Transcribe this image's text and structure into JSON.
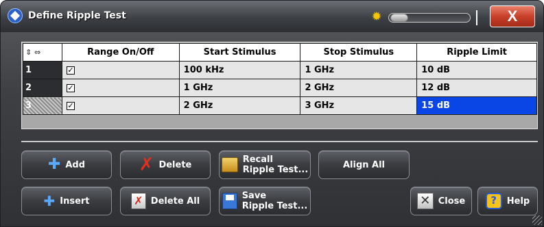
{
  "window": {
    "title": "Define Ripple Test",
    "close_label": "X"
  },
  "table": {
    "headers": [
      "Range On/Off",
      "Start Stimulus",
      "Stop Stimulus",
      "Ripple Limit"
    ],
    "rows": [
      {
        "num": "1",
        "checked": "☑",
        "start": "100 kHz",
        "stop": "1 GHz",
        "limit": "10 dB"
      },
      {
        "num": "2",
        "checked": "☑",
        "start": "1 GHz",
        "stop": "2 GHz",
        "limit": "12 dB"
      },
      {
        "num": "3",
        "checked": "☑",
        "start": "2 GHz",
        "stop": "3 GHz",
        "limit": "15 dB"
      }
    ],
    "selected_row": 3
  },
  "buttons": {
    "add": "Add",
    "delete": "Delete",
    "recall_line1": "Recall",
    "recall_line2": "Ripple Test...",
    "align_all": "Align All",
    "insert": "Insert",
    "delete_all": "Delete All",
    "save_line1": "Save",
    "save_line2": "Ripple Test...",
    "close": "Close",
    "help": "Help"
  },
  "icons": {
    "app": "rs-logo-icon",
    "brightness": "sun-icon",
    "add": "plus-icon",
    "delete": "red-x-icon",
    "recall": "folder-icon",
    "insert": "insert-plus-icon",
    "delete_all": "delete-all-icon",
    "save": "floppy-disk-icon",
    "close": "close-box-icon",
    "help": "help-icon"
  },
  "colors": {
    "selection": "#0a46e6",
    "close_button": "#c8402a"
  }
}
